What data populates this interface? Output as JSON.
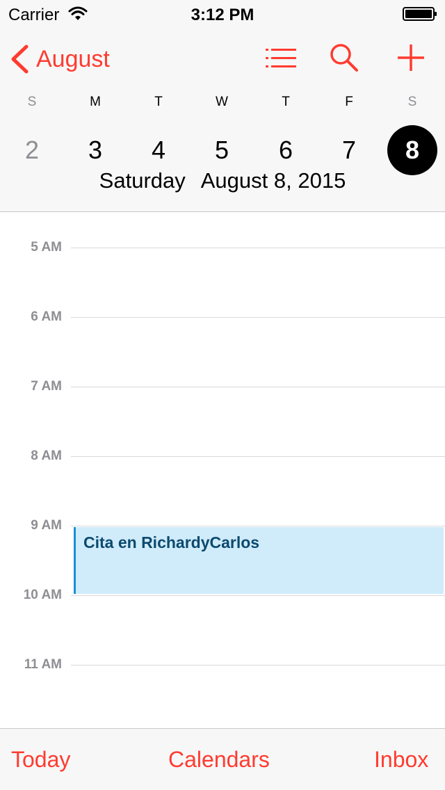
{
  "status_bar": {
    "carrier": "Carrier",
    "time": "3:12 PM",
    "wifi_icon": "wifi-icon",
    "battery_icon": "battery-full-icon"
  },
  "nav": {
    "back_label": "August",
    "back_icon": "chevron-left-icon",
    "list_icon": "list-icon",
    "search_icon": "search-icon",
    "add_icon": "plus-icon"
  },
  "week": {
    "days": [
      {
        "letter": "S",
        "number": "2",
        "weekend": true,
        "selected": false
      },
      {
        "letter": "M",
        "number": "3",
        "weekend": false,
        "selected": false
      },
      {
        "letter": "T",
        "number": "4",
        "weekend": false,
        "selected": false
      },
      {
        "letter": "W",
        "number": "5",
        "weekend": false,
        "selected": false
      },
      {
        "letter": "T",
        "number": "6",
        "weekend": false,
        "selected": false
      },
      {
        "letter": "F",
        "number": "7",
        "weekend": false,
        "selected": false
      },
      {
        "letter": "S",
        "number": "8",
        "weekend": true,
        "selected": true
      }
    ],
    "selected_weekday": "Saturday",
    "selected_full_date": "August 8, 2015"
  },
  "timeline": {
    "hours": [
      "5 AM",
      "6 AM",
      "7 AM",
      "8 AM",
      "9 AM",
      "10 AM",
      "11 AM"
    ]
  },
  "event": {
    "title": "Cita en RichardyCarlos"
  },
  "toolbar": {
    "today_label": "Today",
    "calendars_label": "Calendars",
    "inbox_label": "Inbox"
  },
  "colors": {
    "accent": "#ff3b30",
    "event_fill": "#d0ecfa",
    "event_bar": "#1a8fd8",
    "event_text": "#0c4a6e",
    "selected_day_fill": "#000000"
  }
}
